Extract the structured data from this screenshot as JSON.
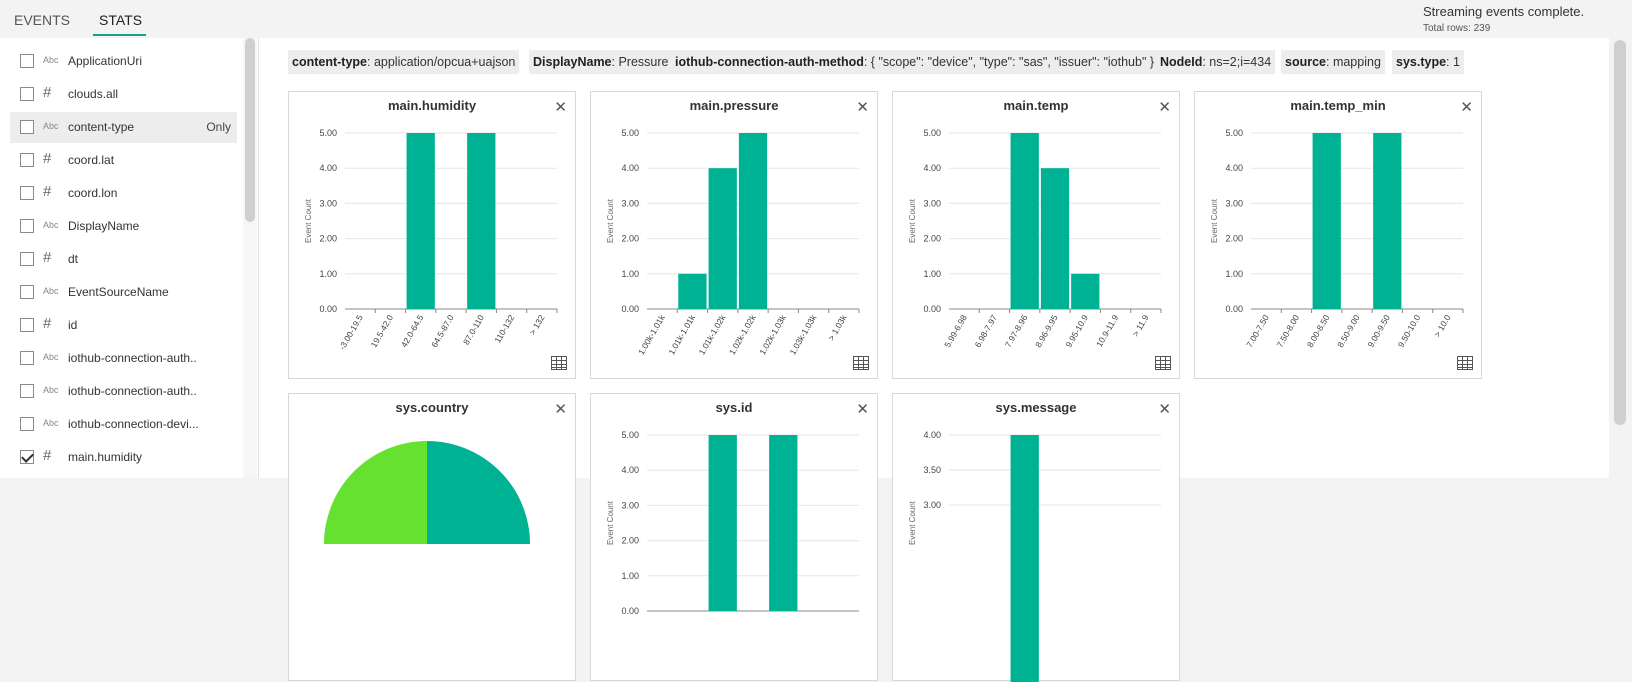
{
  "tabs": {
    "events": "EVENTS",
    "stats": "STATS"
  },
  "status": {
    "message": "Streaming events complete.",
    "rows": "Total rows: 239"
  },
  "sidebar": {
    "items": [
      {
        "type": "Abc",
        "name": "ApplicationUri",
        "checked": false
      },
      {
        "type": "#",
        "name": "clouds.all",
        "checked": false
      },
      {
        "type": "Abc",
        "name": "content-type",
        "checked": false,
        "only": "Only",
        "selected": true
      },
      {
        "type": "#",
        "name": "coord.lat",
        "checked": false
      },
      {
        "type": "#",
        "name": "coord.lon",
        "checked": false
      },
      {
        "type": "Abc",
        "name": "DisplayName",
        "checked": false
      },
      {
        "type": "#",
        "name": "dt",
        "checked": false
      },
      {
        "type": "Abc",
        "name": "EventSourceName",
        "checked": false
      },
      {
        "type": "#",
        "name": "id",
        "checked": false
      },
      {
        "type": "Abc",
        "name": "iothub-connection-auth..",
        "checked": false
      },
      {
        "type": "Abc",
        "name": "iothub-connection-auth..",
        "checked": false
      },
      {
        "type": "Abc",
        "name": "iothub-connection-devi...",
        "checked": false
      },
      {
        "type": "#",
        "name": "main.humidity",
        "checked": true
      }
    ]
  },
  "filters": [
    {
      "key": "content-type",
      "value": ": application/opcua+uajson"
    },
    {
      "key": "DisplayName",
      "value": ": Pressure"
    },
    {
      "key": "iothub-connection-auth-method",
      "value": ": { \"scope\": \"device\", \"type\": \"sas\", \"issuer\": \"iothub\" }"
    },
    {
      "key": "NodeId",
      "value": ": ns=2;i=434"
    },
    {
      "key": "source",
      "value": ": mapping"
    },
    {
      "key": "sys.type",
      "value": ": 1"
    }
  ],
  "colors": {
    "bar": "#00b294",
    "pie_a": "#00b294",
    "pie_b": "#66e12f",
    "accent": "#1a9f8a"
  },
  "chart_data": [
    {
      "type": "bar",
      "title": "main.humidity",
      "ylabel": "Event Count",
      "ylim": [
        0,
        5
      ],
      "yticks": [
        "0.00",
        "1.00",
        "2.00",
        "3.00",
        "4.00",
        "5.00"
      ],
      "categories": [
        "-3.00-19.5",
        "19.5-42.0",
        "42.0-64.5",
        "64.5-87.0",
        "87.0-110",
        "110-132",
        "> 132"
      ],
      "values": [
        0,
        0,
        5,
        0,
        5,
        0,
        0
      ]
    },
    {
      "type": "bar",
      "title": "main.pressure",
      "ylabel": "Event Count",
      "ylim": [
        0,
        5
      ],
      "yticks": [
        "0.00",
        "1.00",
        "2.00",
        "3.00",
        "4.00",
        "5.00"
      ],
      "categories": [
        "1.00k-1.01k",
        "1.01k-1.01k",
        "1.01k-1.02k",
        "1.02k-1.02k",
        "1.02k-1.03k",
        "1.03k-1.03k",
        "> 1.03k"
      ],
      "values": [
        0,
        1,
        4,
        5,
        0,
        0,
        0
      ]
    },
    {
      "type": "bar",
      "title": "main.temp",
      "ylabel": "Event Count",
      "ylim": [
        0,
        5
      ],
      "yticks": [
        "0.00",
        "1.00",
        "2.00",
        "3.00",
        "4.00",
        "5.00"
      ],
      "categories": [
        "5.99-6.98",
        "6.98-7.97",
        "7.97-8.96",
        "8.96-9.95",
        "9.95-10.9",
        "10.9-11.9",
        "> 11.9"
      ],
      "values": [
        0,
        0,
        5,
        4,
        1,
        0,
        0
      ]
    },
    {
      "type": "bar",
      "title": "main.temp_min",
      "ylabel": "Event Count",
      "ylim": [
        0,
        5
      ],
      "yticks": [
        "0.00",
        "1.00",
        "2.00",
        "3.00",
        "4.00",
        "5.00"
      ],
      "categories": [
        "7.00-7.50",
        "7.50-8.00",
        "8.00-8.50",
        "8.50-9.00",
        "9.00-9.50",
        "9.50-10.0",
        "> 10.0"
      ],
      "values": [
        0,
        0,
        5,
        0,
        5,
        0,
        0
      ]
    },
    {
      "type": "pie",
      "title": "sys.country"
    },
    {
      "type": "bar",
      "title": "sys.id",
      "ylabel": "Event Count",
      "ylim": [
        0,
        5
      ],
      "yticks": [
        "0.00",
        "1.00",
        "2.00",
        "3.00",
        "4.00",
        "5.00"
      ],
      "categories": [],
      "values": [
        0,
        0,
        5,
        0,
        5,
        0,
        0
      ]
    },
    {
      "type": "bar",
      "title": "sys.message",
      "ylabel": "Event Count",
      "ylim": [
        0,
        4
      ],
      "yticks": [
        "3.00",
        "3.50",
        "4.00"
      ],
      "categories": [],
      "values": [
        0,
        0,
        4,
        0,
        0,
        0,
        0
      ]
    }
  ]
}
